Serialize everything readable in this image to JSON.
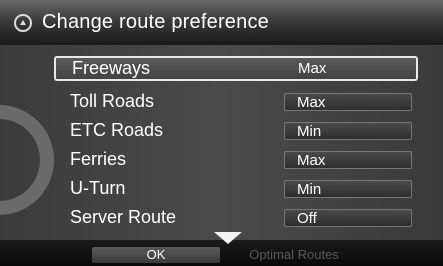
{
  "header": {
    "title": "Change route preference",
    "icon": "circle-arrow-icon"
  },
  "items": [
    {
      "label": "Freeways",
      "value": "Max"
    },
    {
      "label": "Toll Roads",
      "value": "Max"
    },
    {
      "label": "ETC Roads",
      "value": "Min"
    },
    {
      "label": "Ferries",
      "value": "Max"
    },
    {
      "label": "U-Turn",
      "value": "Min"
    },
    {
      "label": "Server Route",
      "value": "Off"
    }
  ],
  "bottom": {
    "ok_label": "OK",
    "optimal_label": "Optimal Routes"
  },
  "colors": {
    "selection_border": "#e8e8e8",
    "text": "#ffffff",
    "disabled_text": "#5a5a5a"
  }
}
